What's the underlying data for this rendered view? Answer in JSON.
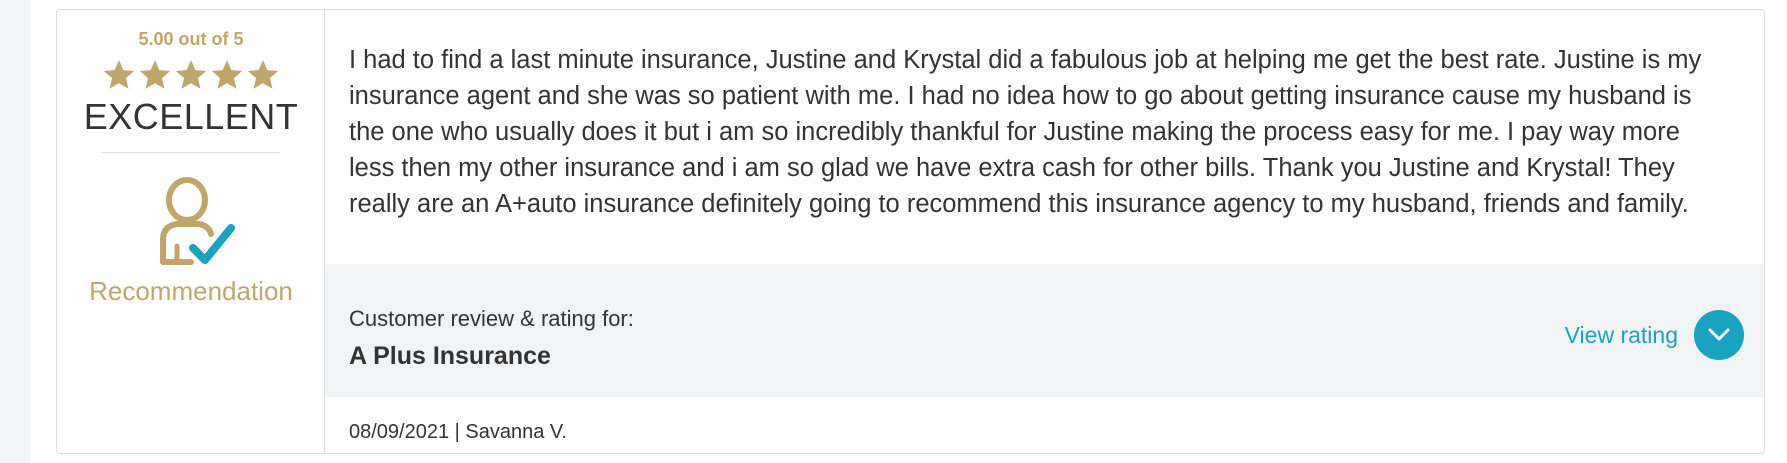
{
  "colors": {
    "gold": "#c0a66b",
    "accent": "#1aa3c0",
    "text": "#333333",
    "bar_bg": "#f2f3f4"
  },
  "rating": {
    "score_text": "5.00 out of 5",
    "stars": 5,
    "grade": "EXCELLENT",
    "recommendation_label": "Recommendation",
    "recommendation_icon": "person-check-icon"
  },
  "review": {
    "text": "I had to find a last minute insurance, Justine and Krystal did a fabulous job at helping me get the best rate. Justine is my insurance agent and she was so patient with me. I had no idea how to go about getting insurance cause my husband is the one who usually does it but i am so incredibly thankful for Justine making the process easy for me. I pay way more less then my other insurance and i am so glad we have extra cash for other bills. Thank you Justine and Krystal! They really are an A+auto insurance definitely going to recommend this insurance agency to my husband, friends and family."
  },
  "business": {
    "label": "Customer review & rating for:",
    "name": "A Plus Insurance"
  },
  "view_rating": {
    "label": "View rating",
    "icon": "chevron-down-icon"
  },
  "meta": {
    "date_author": "08/09/2021 | Savanna V."
  }
}
